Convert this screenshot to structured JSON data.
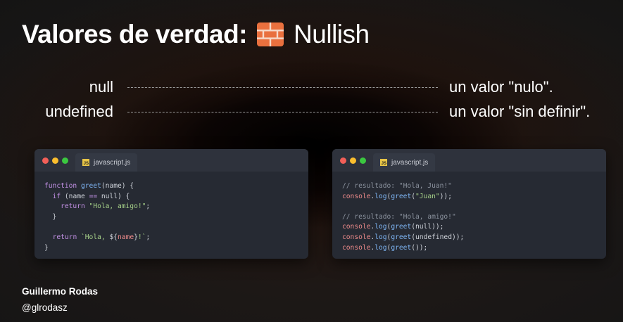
{
  "slide": {
    "title_bold": "Valores de verdad:",
    "title_icon": "brick-icon",
    "title_light": "Nullish"
  },
  "rows": [
    {
      "term": "null",
      "description": "un valor \"nulo\"."
    },
    {
      "term": "undefined",
      "description": "un valor \"sin definir\"."
    }
  ],
  "windows": [
    {
      "tab_label": "javascript.js",
      "lines": [
        [
          {
            "t": "function ",
            "c": "kw"
          },
          {
            "t": "greet",
            "c": "fn"
          },
          {
            "t": "(name) {",
            "c": ""
          }
        ],
        [
          {
            "t": "  ",
            "c": ""
          },
          {
            "t": "if",
            "c": "kw"
          },
          {
            "t": " (name ",
            "c": ""
          },
          {
            "t": "==",
            "c": "kw"
          },
          {
            "t": " null) {",
            "c": ""
          }
        ],
        [
          {
            "t": "    ",
            "c": ""
          },
          {
            "t": "return",
            "c": "kw"
          },
          {
            "t": " ",
            "c": ""
          },
          {
            "t": "\"Hola, amigo!\"",
            "c": "str"
          },
          {
            "t": ";",
            "c": ""
          }
        ],
        [
          {
            "t": "  }",
            "c": ""
          }
        ],
        [
          {
            "t": "",
            "c": ""
          }
        ],
        [
          {
            "t": "  ",
            "c": ""
          },
          {
            "t": "return",
            "c": "kw"
          },
          {
            "t": " ",
            "c": ""
          },
          {
            "t": "`Hola, ",
            "c": "tpl"
          },
          {
            "t": "${",
            "c": ""
          },
          {
            "t": "name",
            "c": "var"
          },
          {
            "t": "}",
            "c": ""
          },
          {
            "t": "!`",
            "c": "tpl"
          },
          {
            "t": ";",
            "c": ""
          }
        ],
        [
          {
            "t": "}",
            "c": ""
          }
        ]
      ]
    },
    {
      "tab_label": "javascript.js",
      "lines": [
        [
          {
            "t": "// resultado: \"Hola, Juan!\"",
            "c": "cmt"
          }
        ],
        [
          {
            "t": "console",
            "c": "obj"
          },
          {
            "t": ".",
            "c": ""
          },
          {
            "t": "log",
            "c": "fn"
          },
          {
            "t": "(",
            "c": ""
          },
          {
            "t": "greet",
            "c": "fn"
          },
          {
            "t": "(",
            "c": ""
          },
          {
            "t": "\"Juan\"",
            "c": "str"
          },
          {
            "t": "));",
            "c": ""
          }
        ],
        [
          {
            "t": "",
            "c": ""
          }
        ],
        [
          {
            "t": "// resultado: \"Hola, amigo!\"",
            "c": "cmt"
          }
        ],
        [
          {
            "t": "console",
            "c": "obj"
          },
          {
            "t": ".",
            "c": ""
          },
          {
            "t": "log",
            "c": "fn"
          },
          {
            "t": "(",
            "c": ""
          },
          {
            "t": "greet",
            "c": "fn"
          },
          {
            "t": "(null));",
            "c": ""
          }
        ],
        [
          {
            "t": "console",
            "c": "obj"
          },
          {
            "t": ".",
            "c": ""
          },
          {
            "t": "log",
            "c": "fn"
          },
          {
            "t": "(",
            "c": ""
          },
          {
            "t": "greet",
            "c": "fn"
          },
          {
            "t": "(undefined));",
            "c": ""
          }
        ],
        [
          {
            "t": "console",
            "c": "obj"
          },
          {
            "t": ".",
            "c": ""
          },
          {
            "t": "log",
            "c": "fn"
          },
          {
            "t": "(",
            "c": ""
          },
          {
            "t": "greet",
            "c": "fn"
          },
          {
            "t": "());",
            "c": ""
          }
        ]
      ]
    }
  ],
  "colors": {
    "dot_close": "#f25f58",
    "dot_minimize": "#fbbe2e",
    "dot_maximize": "#3bc840",
    "brick": "#e9703e"
  },
  "author": {
    "name": "Guillermo Rodas",
    "handle": "@glrodasz"
  }
}
